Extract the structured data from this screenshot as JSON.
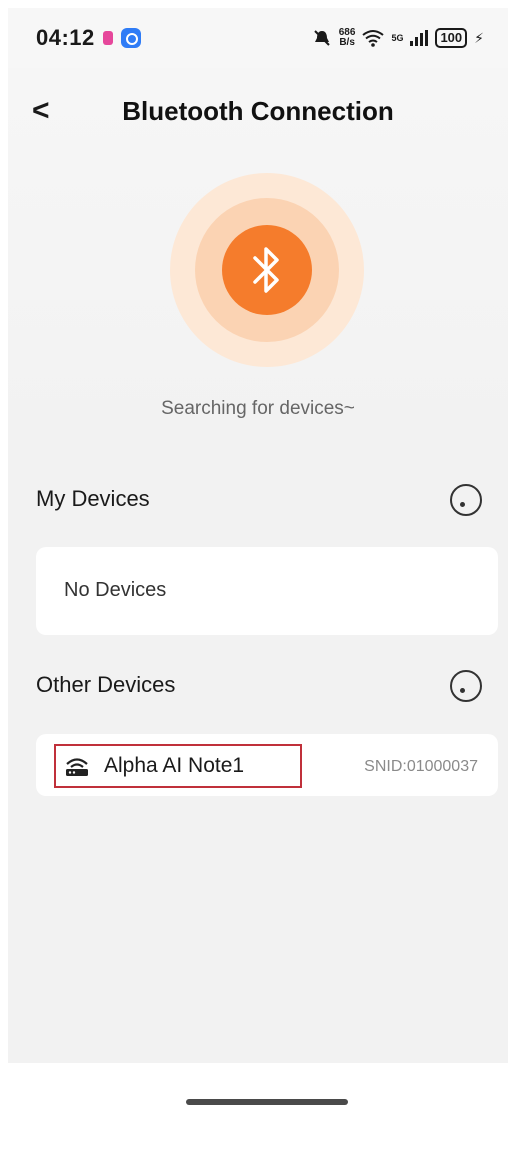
{
  "status_bar": {
    "time": "04:12",
    "net_speed_value": "686",
    "net_speed_unit": "B/s",
    "signal_label": "5G",
    "battery": "100"
  },
  "header": {
    "back_symbol": "<",
    "title": "Bluetooth Connection"
  },
  "scan": {
    "icon": "bluetooth-icon",
    "status_text": "Searching for devices~",
    "accent_color": "#f57c2c"
  },
  "my_devices": {
    "title": "My Devices",
    "empty_text": "No Devices"
  },
  "other_devices": {
    "title": "Other Devices",
    "items": [
      {
        "name": "Alpha AI Note1",
        "snid": "SNID:01000037",
        "icon": "router-icon"
      }
    ]
  }
}
